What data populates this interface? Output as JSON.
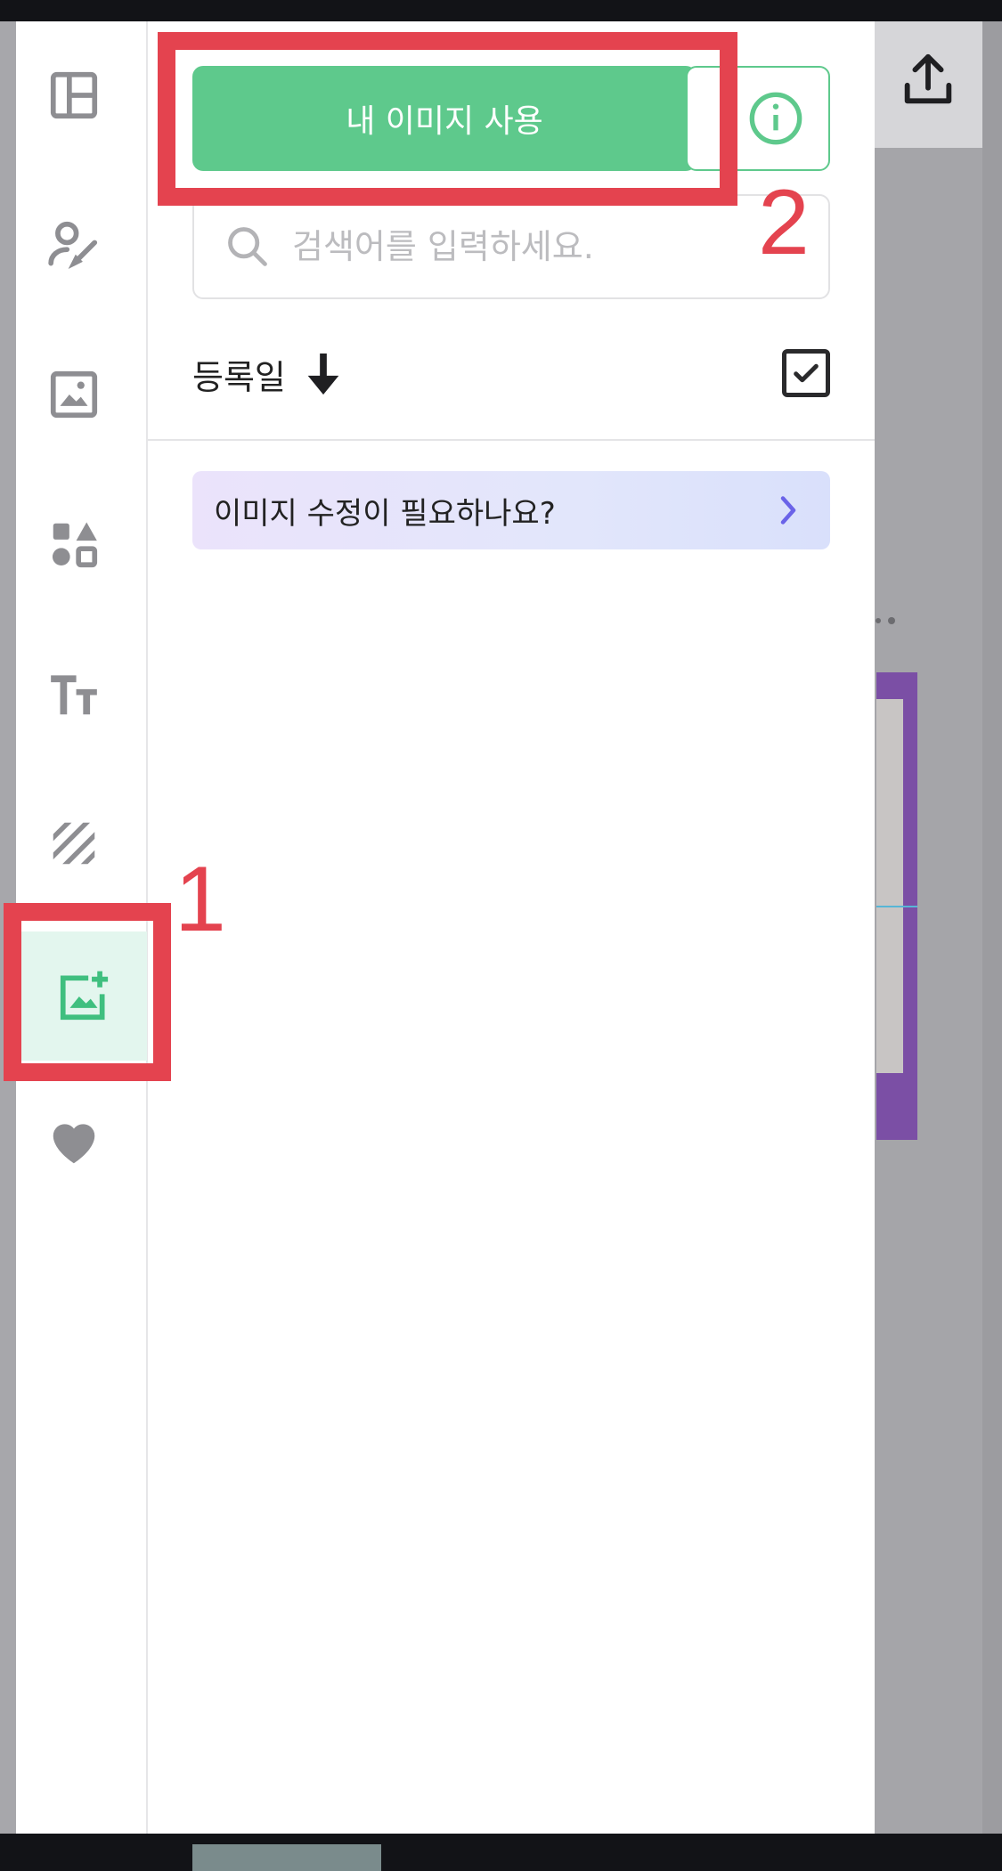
{
  "header": {
    "use_my_image_label": "내 이미지 사용",
    "info_icon": "info-circle-icon",
    "upload_icon": "upload-icon"
  },
  "search": {
    "placeholder": "검색어를 입력하세요.",
    "value": ""
  },
  "sort": {
    "label": "등록일",
    "direction_icon": "arrow-down-icon",
    "checkbox_checked": true
  },
  "promo": {
    "text": "이미지 수정이 필요하나요?",
    "icon": "chevron-right-icon"
  },
  "sidebar": {
    "items": [
      {
        "name": "template",
        "icon": "layout-icon"
      },
      {
        "name": "design-element",
        "icon": "user-brush-icon"
      },
      {
        "name": "photo",
        "icon": "image-icon"
      },
      {
        "name": "elements",
        "icon": "shapes-icon"
      },
      {
        "name": "text",
        "icon": "text-icon"
      },
      {
        "name": "background",
        "icon": "pattern-icon"
      },
      {
        "name": "upload",
        "icon": "image-add-icon",
        "active": true
      },
      {
        "name": "favorites",
        "icon": "heart-icon"
      }
    ]
  },
  "annotations": {
    "label_1": "1",
    "label_2": "2"
  },
  "colors": {
    "accent": "#5ec98c",
    "annotation": "#e4434f",
    "active_bg": "#e3f6ee",
    "icon_gray": "#8e8e92"
  }
}
